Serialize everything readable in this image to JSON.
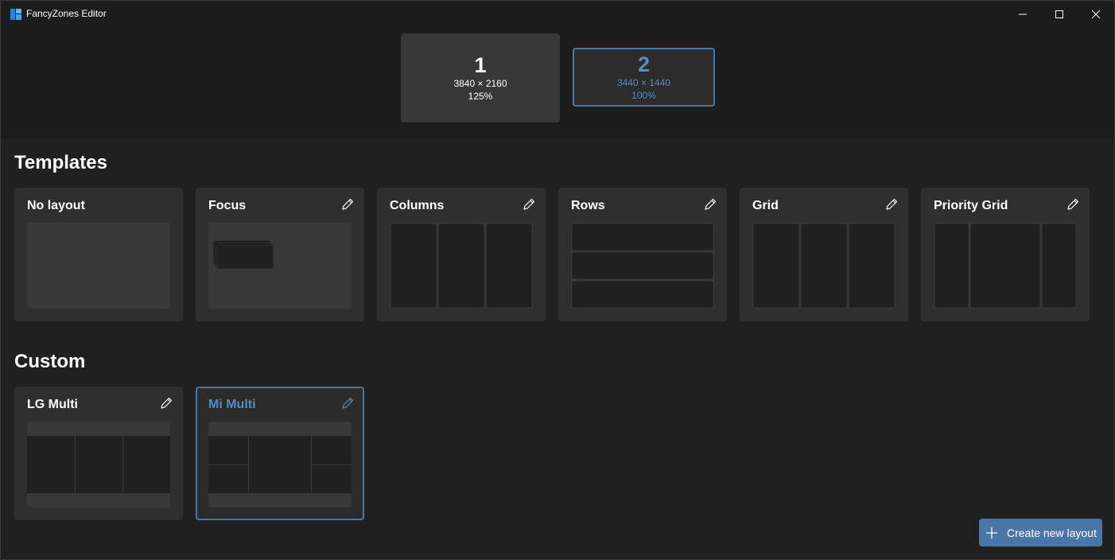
{
  "window": {
    "title": "FancyZones Editor"
  },
  "monitors": [
    {
      "number": "1",
      "resolution": "3840 × 2160",
      "scale": "125%",
      "selected": false
    },
    {
      "number": "2",
      "resolution": "3440 × 1440",
      "scale": "100%",
      "selected": true
    }
  ],
  "templates": {
    "heading": "Templates",
    "items": [
      {
        "name": "No layout",
        "editable": false
      },
      {
        "name": "Focus",
        "editable": true
      },
      {
        "name": "Columns",
        "editable": true
      },
      {
        "name": "Rows",
        "editable": true
      },
      {
        "name": "Grid",
        "editable": true
      },
      {
        "name": "Priority Grid",
        "editable": true
      }
    ]
  },
  "custom": {
    "heading": "Custom",
    "items": [
      {
        "name": "LG Multi",
        "selected": false
      },
      {
        "name": "Mi Multi",
        "selected": true
      }
    ]
  },
  "actions": {
    "create_label": "Create new layout"
  },
  "colors": {
    "accent": "#4a76a5",
    "background": "#202020",
    "card": "#2f2f2f"
  },
  "icons": {
    "edit": "pencil-icon",
    "create": "plus-icon"
  }
}
